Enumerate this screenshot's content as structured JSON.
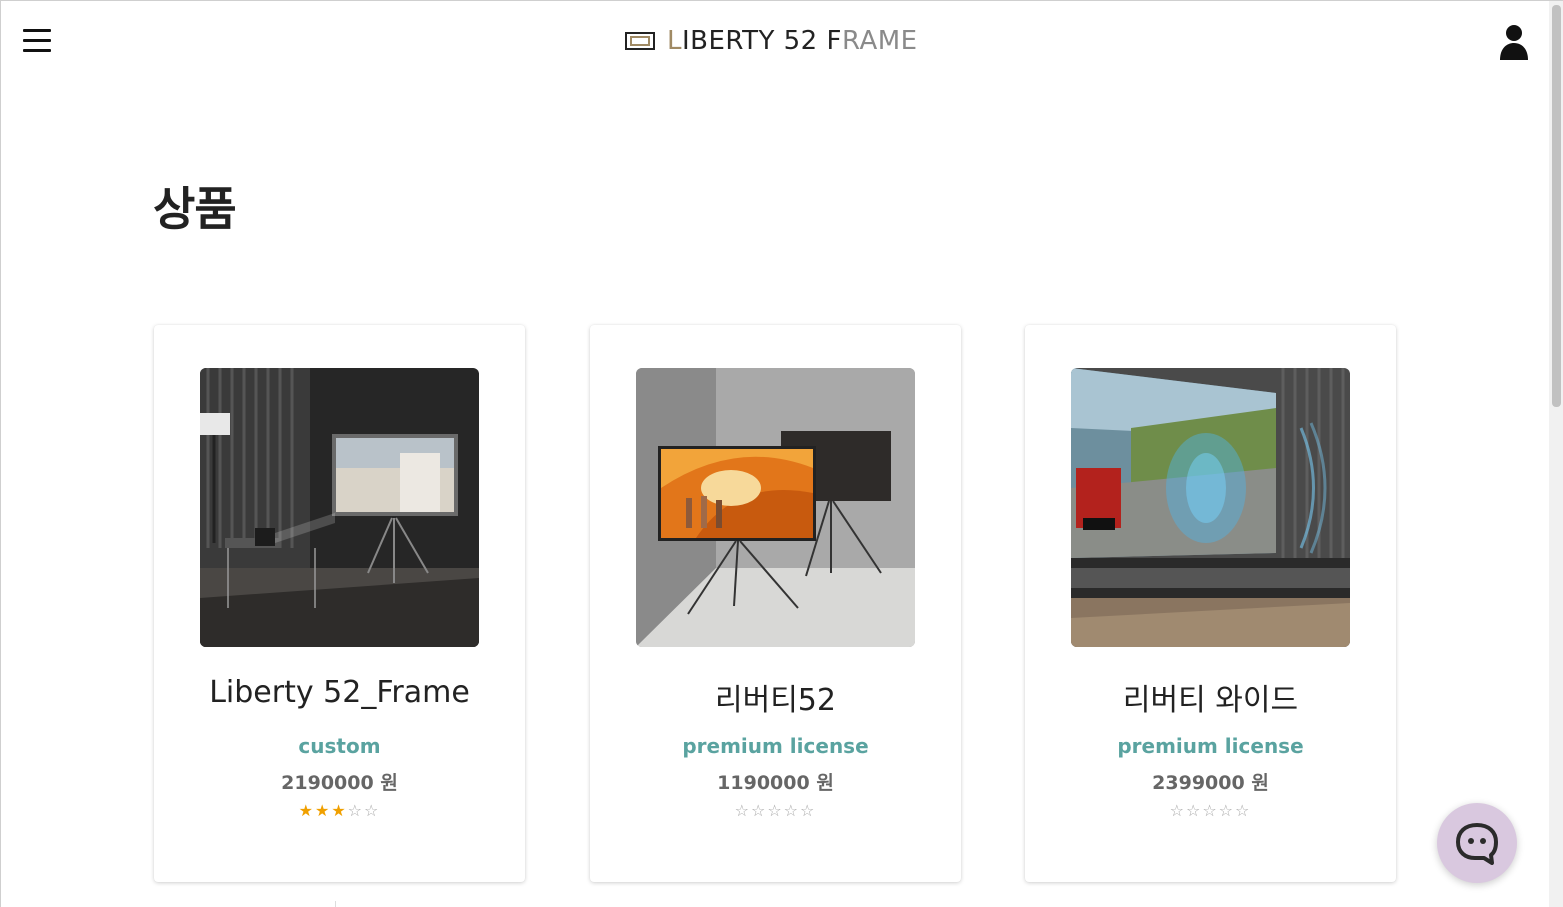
{
  "header": {
    "logo": {
      "parts": [
        {
          "text": "L",
          "tone": "gold"
        },
        {
          "text": "IBERTY 52 F",
          "tone": "dark"
        },
        {
          "text": "RAME",
          "tone": "gray"
        }
      ]
    },
    "menu_icon": "hamburger-menu-icon",
    "user_icon": "user-icon"
  },
  "page": {
    "title": "상품"
  },
  "products": [
    {
      "name": "Liberty 52_Frame",
      "tag": "custom",
      "price": "2190000 원",
      "rating": 3,
      "rating_max": 5
    },
    {
      "name": "리버티52",
      "tag": "premium license",
      "price": "1190000 원",
      "rating": 0,
      "rating_max": 5
    },
    {
      "name": "리버티 와이드",
      "tag": "premium license",
      "price": "2399000 원",
      "rating": 0,
      "rating_max": 5
    }
  ],
  "colors": {
    "accent_teal": "#5aa3a0",
    "star_filled": "#f0a000",
    "chat_button": "#d9c8df",
    "logo_gold": "#a08a64"
  },
  "chat": {
    "icon": "chat-bubble-icon"
  }
}
